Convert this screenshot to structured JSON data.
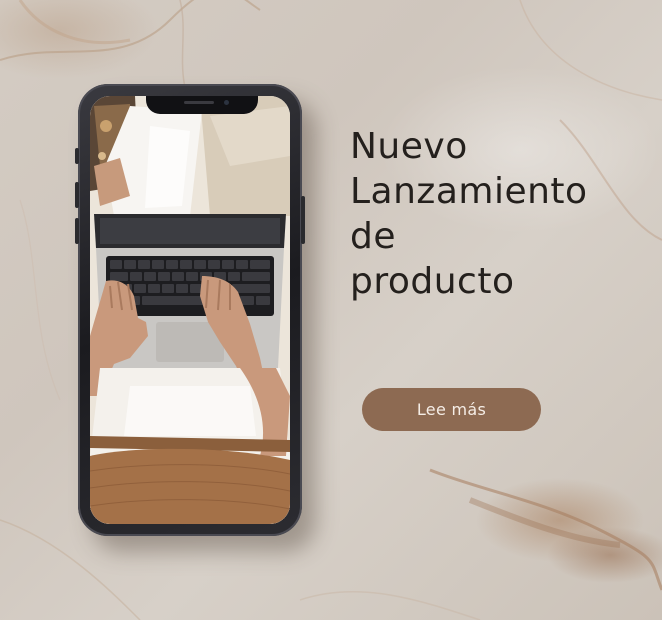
{
  "headline": {
    "line1": "Nuevo",
    "line2": "Lanzamiento",
    "line3": "de",
    "line4": "producto"
  },
  "cta": {
    "label": "Lee más"
  },
  "colors": {
    "background": "#d2c9c0",
    "text": "#24201d",
    "button": "#8d6a52",
    "button_text": "#f5ede6",
    "phone_frame": "#1b1b1f"
  },
  "device": {
    "icon": "smartphone-icon",
    "screen_content": "person-typing-on-laptop-photo"
  }
}
